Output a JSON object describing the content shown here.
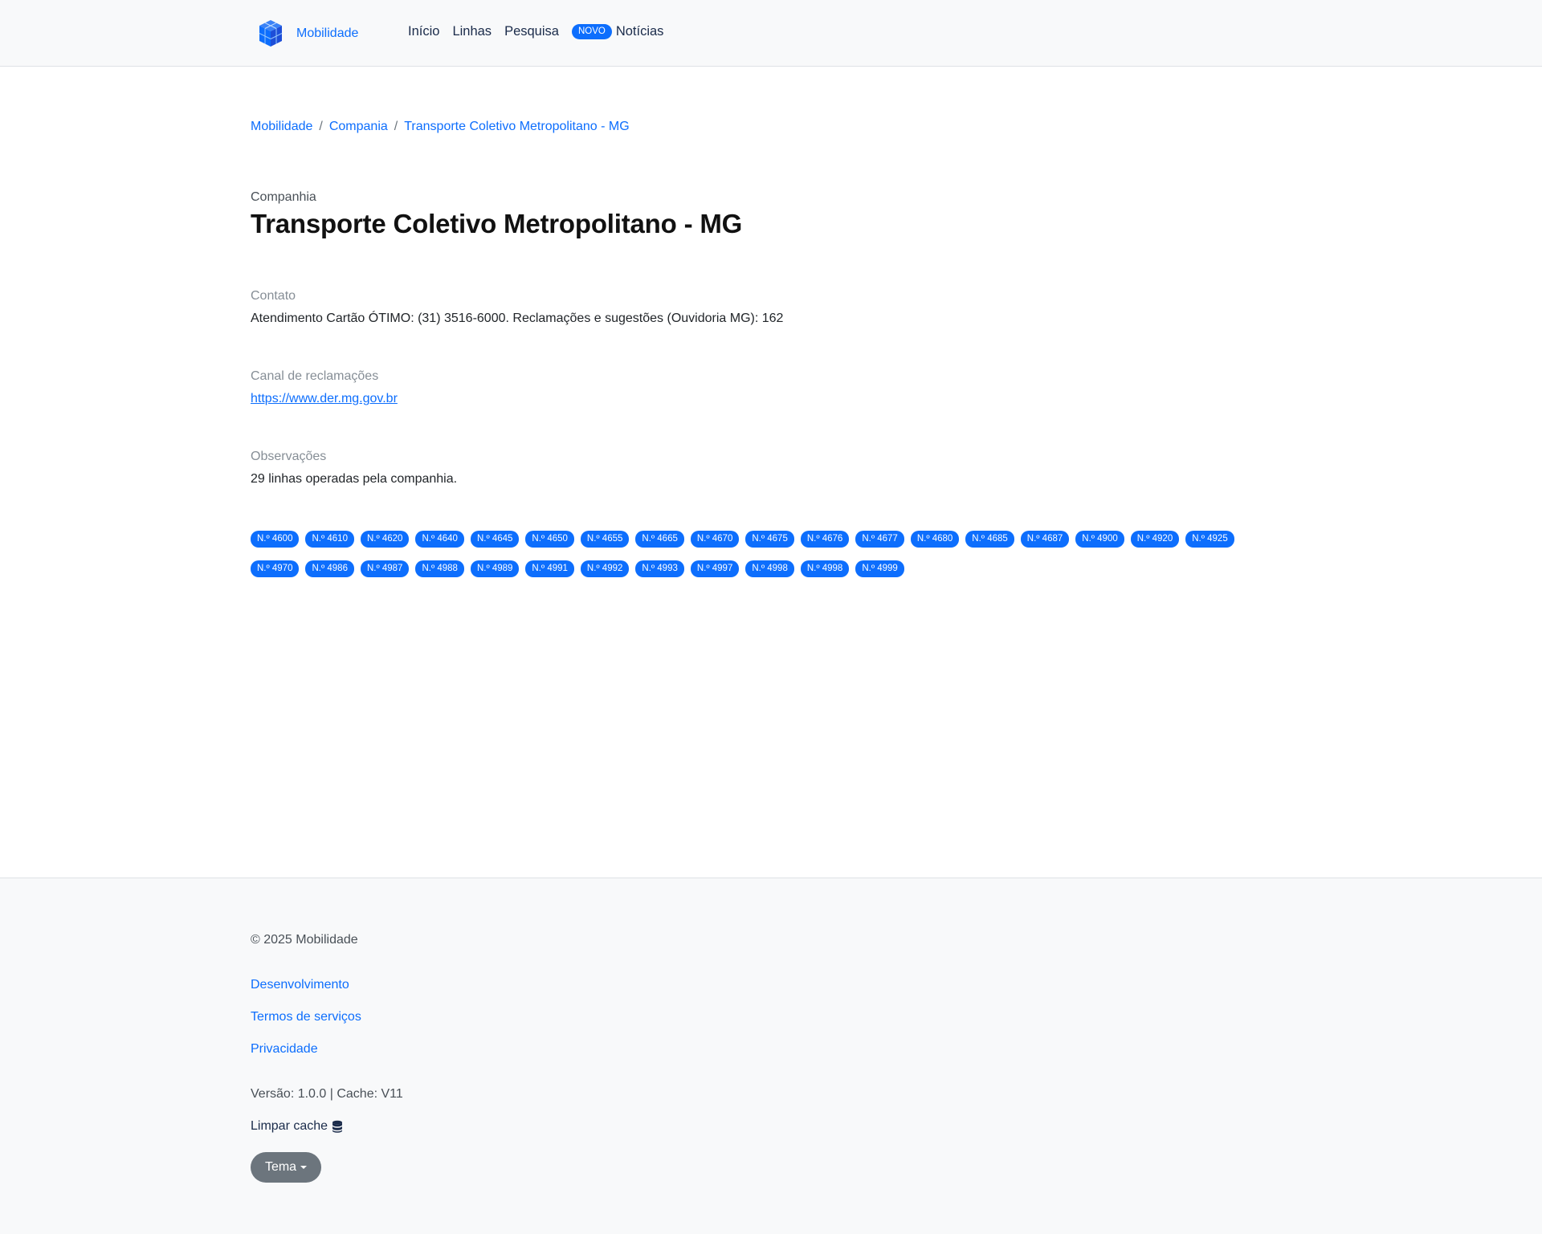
{
  "header": {
    "brand": "Mobilidade",
    "nav": {
      "inicio": "Início",
      "linhas": "Linhas",
      "pesquisa": "Pesquisa",
      "novo_badge": "NOVO",
      "noticias": "Notícias"
    }
  },
  "breadcrumb": [
    "Mobilidade",
    "Compania",
    "Transporte Coletivo Metropolitano - MG"
  ],
  "main": {
    "kicker": "Companhia",
    "title": "Transporte Coletivo Metropolitano - MG",
    "contato_label": "Contato",
    "contato_value": "Atendimento Cartão ÓTIMO: (31) 3516-6000. Reclamações e sugestões (Ouvidoria MG): 162",
    "canal_label": "Canal de reclamações",
    "canal_link": "https://www.der.mg.gov.br",
    "obs_label": "Observações",
    "obs_value": "29 linhas operadas pela companhia.",
    "lines": [
      "N.º 4600",
      "N.º 4610",
      "N.º 4620",
      "N.º 4640",
      "N.º 4645",
      "N.º 4650",
      "N.º 4655",
      "N.º 4665",
      "N.º 4670",
      "N.º 4675",
      "N.º 4676",
      "N.º 4677",
      "N.º 4680",
      "N.º 4685",
      "N.º 4687",
      "N.º 4900",
      "N.º 4920",
      "N.º 4925",
      "N.º 4970",
      "N.º 4986",
      "N.º 4987",
      "N.º 4988",
      "N.º 4989",
      "N.º 4991",
      "N.º 4992",
      "N.º 4993",
      "N.º 4997",
      "N.º 4998",
      "N.º 4998",
      "N.º 4999"
    ]
  },
  "footer": {
    "copyright": "© 2025 Mobilidade",
    "links": {
      "desenvolvimento": "Desenvolvimento",
      "termos": "Termos de serviços",
      "privacidade": "Privacidade"
    },
    "version": "Versão: 1.0.0 | Cache: V11",
    "clear_cache": "Limpar cache",
    "clear_cache_icon": "database-icon",
    "theme_button": "Tema"
  },
  "colors": {
    "primary": "#0d6efd",
    "header_bg": "#f8f9fa",
    "theme_button_bg": "#6c757d"
  }
}
